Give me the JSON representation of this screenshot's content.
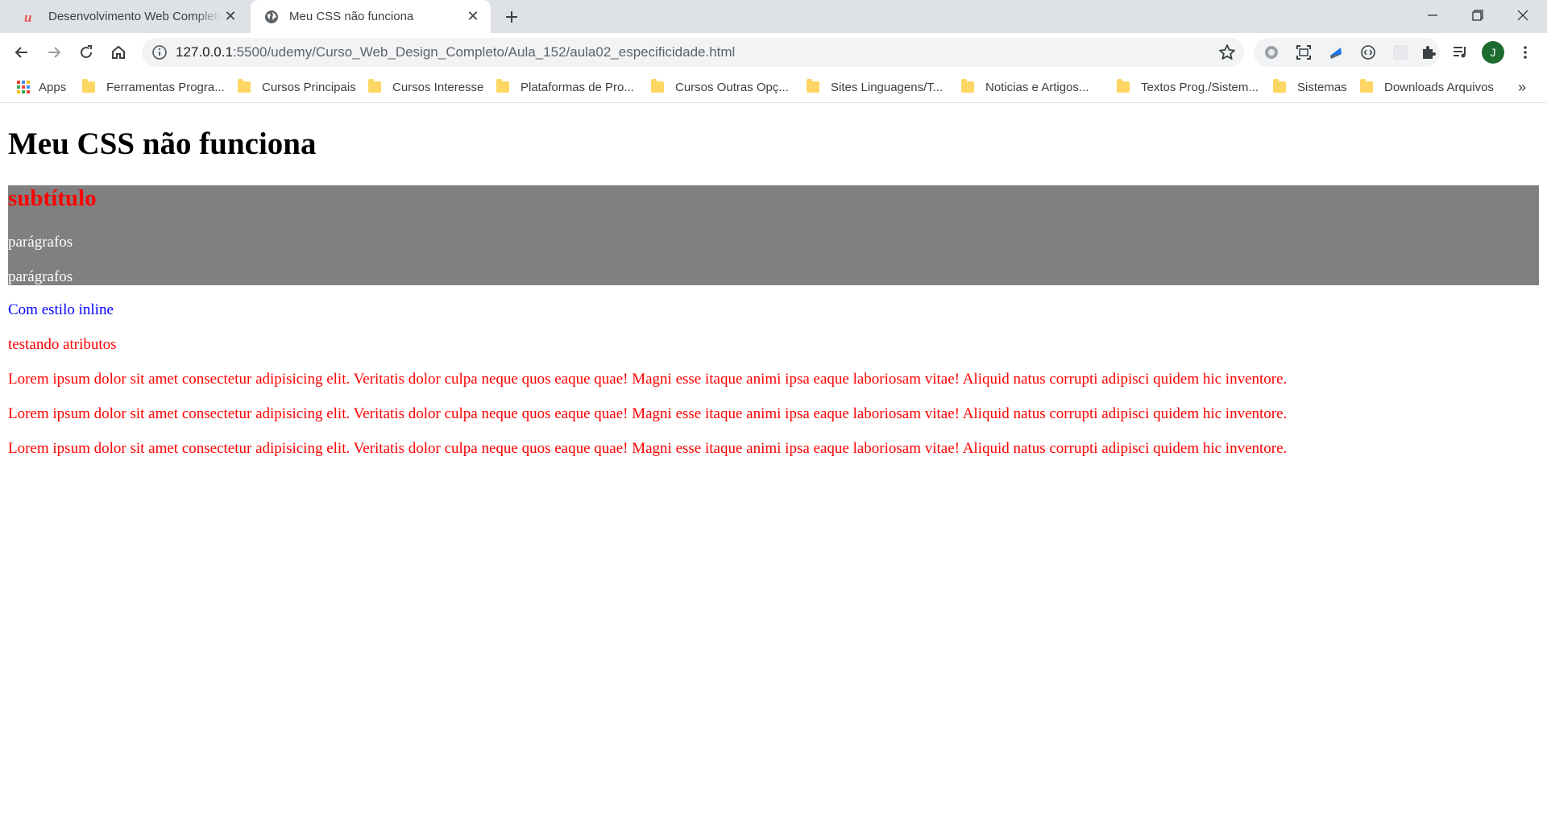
{
  "tabs": [
    {
      "title": "Desenvolvimento Web Completo",
      "active": false,
      "favicon": "udemy-icon"
    },
    {
      "title": "Meu CSS não funciona",
      "active": true,
      "favicon": "globe-icon"
    }
  ],
  "address_bar": {
    "host": "127.0.0.1",
    "path": ":5500/udemy/Curso_Web_Design_Completo/Aula_152/aula02_especificidade.html"
  },
  "profile": {
    "initial": "J",
    "color": "#1e6b2f"
  },
  "bookmarks": [
    "Apps",
    "Ferramentas Progra...",
    "Cursos Principais",
    "Cursos Interesse",
    "Plataformas de Pro...",
    "Cursos Outras Opç...",
    "Sites Linguagens/T...",
    "Noticias e Artigos...",
    "Textos Prog./Sistem...",
    "Sistemas",
    "Downloads Arquivos"
  ],
  "bookmarks_more": "»",
  "page": {
    "heading": "Meu CSS não funciona",
    "subheading": "subtítulo",
    "box_paragraphs": [
      "parágrafos",
      "parágrafos"
    ],
    "inline_text": "Com estilo inline",
    "attr_text": "testando atributos",
    "lorem": [
      "Lorem ipsum dolor sit amet consectetur adipisicing elit. Veritatis dolor culpa neque quos eaque quae! Magni esse itaque animi ipsa eaque laboriosam vitae! Aliquid natus corrupti adipisci quidem hic inventore.",
      "Lorem ipsum dolor sit amet consectetur adipisicing elit. Veritatis dolor culpa neque quos eaque quae! Magni esse itaque animi ipsa eaque laboriosam vitae! Aliquid natus corrupti adipisci quidem hic inventore.",
      "Lorem ipsum dolor sit amet consectetur adipisicing elit. Veritatis dolor culpa neque quos eaque quae! Magni esse itaque animi ipsa eaque laboriosam vitae! Aliquid natus corrupti adipisci quidem hic inventore."
    ]
  },
  "colors": {
    "heading": "#000000",
    "subheading": "#ff0000",
    "box_bg": "#808080",
    "box_text": "#ffffff",
    "inline_text": "#0000ff",
    "red_text": "#ff0000"
  }
}
